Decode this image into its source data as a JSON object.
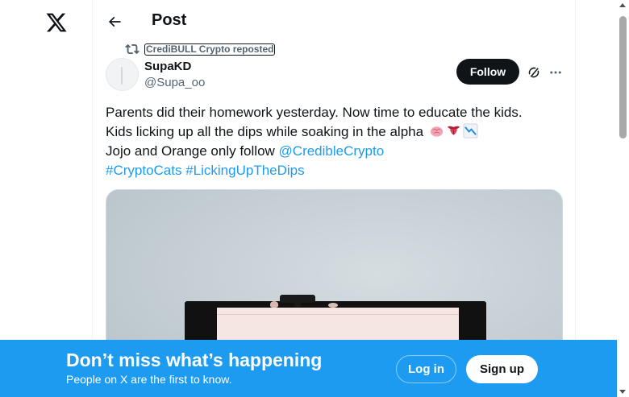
{
  "nav": {
    "logo_icon": "x-logo-icon",
    "back_icon": "arrow-left-icon",
    "title": "Post"
  },
  "repost": {
    "icon": "repost-icon",
    "label": "CrediBULL Crypto reposted"
  },
  "author": {
    "name": "SupaKD",
    "handle": "@Supa_oo"
  },
  "actions": {
    "follow_label": "Follow",
    "grok_icon": "grok-icon",
    "more_icon": "more-dots-icon"
  },
  "tweet": {
    "line1": "Parents did their homework yesterday. Now time to educate the kids.",
    "line2": "Kids licking up all the dips while soaking in the alpha",
    "line2_emojis": [
      "brain-emoji",
      "tongue-emoji",
      "chart-down-emoji"
    ],
    "line3_prefix": "Jojo and Orange only follow ",
    "mention": "@CredibleCrypto",
    "hashtag1": "#CryptoCats",
    "hashtag2": "#LickingUpTheDips"
  },
  "media": {
    "icon": "photo-media"
  },
  "banner": {
    "title": "Don’t miss what’s happening",
    "subtitle": "People on X are the first to know.",
    "login_label": "Log in",
    "signup_label": "Sign up"
  },
  "colors": {
    "accent": "#1d9bf0",
    "text_primary": "#0f1419",
    "text_secondary": "#536471",
    "follow_bg": "#0f1419"
  }
}
